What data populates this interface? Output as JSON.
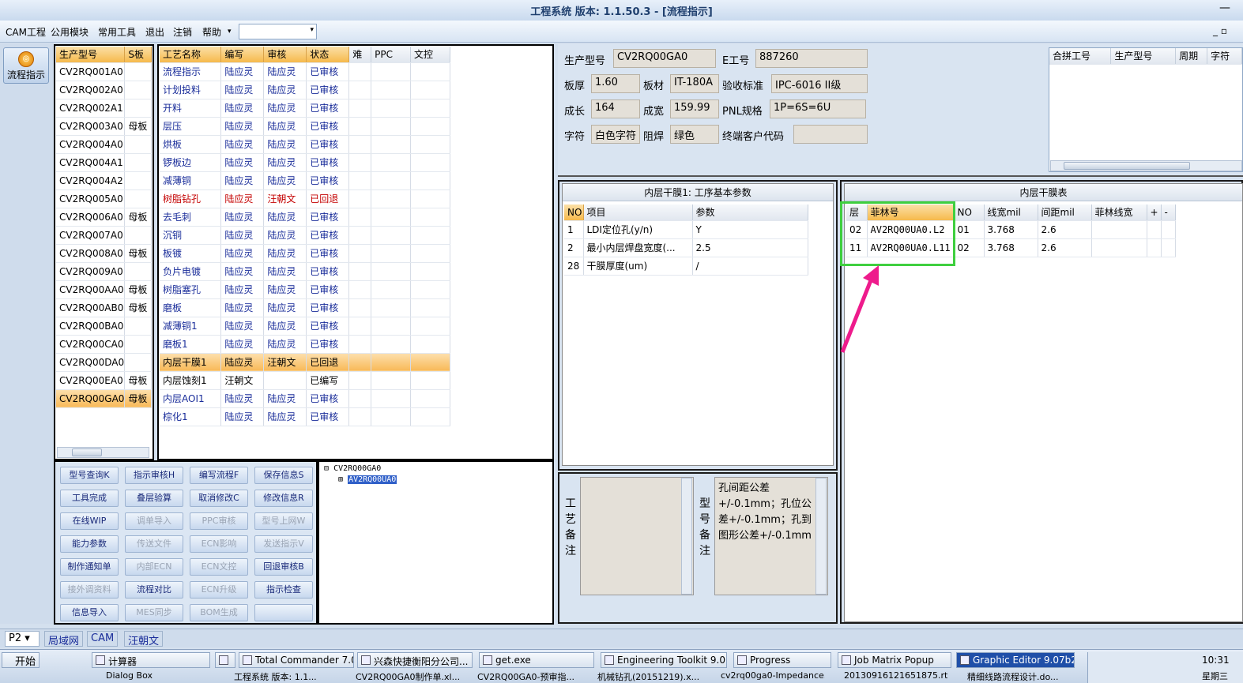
{
  "window": {
    "title": "工程系统  版本: 1.1.50.3 - [流程指示]"
  },
  "menu": {
    "items": [
      "CAM工程",
      "公用模块",
      "常用工具",
      "退出",
      "注销",
      "帮助"
    ],
    "dropdown_glyph": "▾"
  },
  "left_button": {
    "label": "流程指示"
  },
  "model_table": {
    "headers": [
      "生产型号",
      "S板"
    ],
    "rows": [
      [
        "CV2RQ001A0",
        ""
      ],
      [
        "CV2RQ002A0",
        ""
      ],
      [
        "CV2RQ002A1",
        ""
      ],
      [
        "CV2RQ003A0",
        "母板"
      ],
      [
        "CV2RQ004A0",
        ""
      ],
      [
        "CV2RQ004A1",
        ""
      ],
      [
        "CV2RQ004A2",
        ""
      ],
      [
        "CV2RQ005A0",
        ""
      ],
      [
        "CV2RQ006A0",
        "母板"
      ],
      [
        "CV2RQ007A0",
        ""
      ],
      [
        "CV2RQ008A0",
        "母板"
      ],
      [
        "CV2RQ009A0",
        ""
      ],
      [
        "CV2RQ00AA0",
        "母板"
      ],
      [
        "CV2RQ00AB0",
        "母板"
      ],
      [
        "CV2RQ00BA0",
        ""
      ],
      [
        "CV2RQ00CA0",
        ""
      ],
      [
        "CV2RQ00DA0",
        ""
      ],
      [
        "CV2RQ00EA0",
        "母板"
      ],
      [
        "CV2RQ00GA0",
        "母板"
      ]
    ],
    "selected_index": 18
  },
  "process_table": {
    "headers": [
      "工艺名称",
      "编写",
      "审核",
      "状态",
      "难",
      "PPC",
      "文控"
    ],
    "rows": [
      [
        "流程指示",
        "陆应灵",
        "陆应灵",
        "已审核"
      ],
      [
        "计划投料",
        "陆应灵",
        "陆应灵",
        "已审核"
      ],
      [
        "开料",
        "陆应灵",
        "陆应灵",
        "已审核"
      ],
      [
        "层压",
        "陆应灵",
        "陆应灵",
        "已审核"
      ],
      [
        "烘板",
        "陆应灵",
        "陆应灵",
        "已审核"
      ],
      [
        "锣板边",
        "陆应灵",
        "陆应灵",
        "已审核"
      ],
      [
        "减薄铜",
        "陆应灵",
        "陆应灵",
        "已审核"
      ],
      [
        "树脂钻孔",
        "陆应灵",
        "汪朝文",
        "已回退"
      ],
      [
        "去毛刺",
        "陆应灵",
        "陆应灵",
        "已审核"
      ],
      [
        "沉铜",
        "陆应灵",
        "陆应灵",
        "已审核"
      ],
      [
        "板镀",
        "陆应灵",
        "陆应灵",
        "已审核"
      ],
      [
        "负片电镀",
        "陆应灵",
        "陆应灵",
        "已审核"
      ],
      [
        "树脂塞孔",
        "陆应灵",
        "陆应灵",
        "已审核"
      ],
      [
        "磨板",
        "陆应灵",
        "陆应灵",
        "已审核"
      ],
      [
        "减薄铜1",
        "陆应灵",
        "陆应灵",
        "已审核"
      ],
      [
        "磨板1",
        "陆应灵",
        "陆应灵",
        "已审核"
      ],
      [
        "内层干膜1",
        "陆应灵",
        "汪朝文",
        "已回退"
      ],
      [
        "内层蚀刻1",
        "汪朝文",
        "",
        "已编写"
      ],
      [
        "内层AOI1",
        "陆应灵",
        "陆应灵",
        "已审核"
      ],
      [
        "棕化1",
        "陆应灵",
        "陆应灵",
        "已审核"
      ]
    ],
    "selected_index": 16,
    "red_index": 7,
    "black_indices": [
      16,
      17
    ]
  },
  "buttons": [
    [
      "型号查询K",
      "指示审核H",
      "编写流程F",
      "保存信息S"
    ],
    [
      "工具完成",
      "叠层验算",
      "取消修改C",
      "修改信息R"
    ],
    [
      "在线WIP",
      "调单导入",
      "PPC审核",
      "型号上网W"
    ],
    [
      "能力参数",
      "传送文件",
      "ECN影响",
      "发送指示V"
    ],
    [
      "制作通知单",
      "内部ECN",
      "ECN文控",
      "回退审核B"
    ],
    [
      "接外调资料",
      "流程对比",
      "ECN升级",
      "指示检查"
    ],
    [
      "信息导入",
      "MES同步",
      "BOM生成",
      ""
    ]
  ],
  "disabled_buttons": [
    "调单导入",
    "PPC审核",
    "型号上网W",
    "传送文件",
    "ECN影响",
    "发送指示V",
    "内部ECN",
    "ECN文控",
    "接外调资料",
    "ECN升级",
    "MES同步",
    "BOM生成"
  ],
  "tree": {
    "root": "CV2RQ00GA0",
    "child": "AV2RQ00UA0",
    "expander": "⊟",
    "child_expander": "⊞"
  },
  "info": {
    "生产型号_label": "生产型号",
    "生产型号": "CV2RQ00GA0",
    "E工号_label": "E工号",
    "E工号": "887260",
    "板厚_label": "板厚",
    "板厚": "1.60",
    "板材_label": "板材",
    "板材": "IT-180A",
    "验收标准_label": "验收标准",
    "验收标准": "IPC-6016 II级",
    "成长_label": "成长",
    "成长": "164",
    "成宽_label": "成宽",
    "成宽": "159.99",
    "PNL规格_label": "PNL规格",
    "PNL规格": "1P=6S=6U",
    "字符_label": "字符",
    "字符": "白色字符",
    "阻焊_label": "阻焊",
    "阻焊": "绿色",
    "终端客户代码_label": "终端客户代码",
    "终端客户代码": ""
  },
  "merge_table": {
    "headers": [
      "合拼工号",
      "生产型号",
      "周期",
      "字符"
    ]
  },
  "params": {
    "title": "内层干膜1: 工序基本参数",
    "headers": [
      "NO",
      "项目",
      "参数"
    ],
    "rows": [
      [
        "1",
        "LDI定位孔(y/n)",
        "Y"
      ],
      [
        "2",
        "最小内层焊盘宽度(...",
        "2.5"
      ],
      [
        "28",
        "干膜厚度(um)",
        "/"
      ]
    ]
  },
  "film": {
    "title": "内层干膜表",
    "headers": [
      "层",
      "菲林号",
      "NO",
      "线宽mil",
      "间距mil",
      "菲林线宽",
      "+",
      "-"
    ],
    "rows": [
      [
        "02",
        "AV2RQ00UA0.L2",
        "01",
        "3.768",
        "2.6"
      ],
      [
        "11",
        "AV2RQ00UA0.L11",
        "02",
        "3.768",
        "2.6"
      ]
    ]
  },
  "notes": {
    "process_label": "工艺备注",
    "model_label": "型号备注",
    "process_text": "",
    "model_text": "孔间距公差+/-0.1mm；孔位公差+/-0.1mm；孔到图形公差+/-0.1mm"
  },
  "status": {
    "left": "P2",
    "tabs": [
      "局域网",
      "CAM",
      "汪朝文"
    ]
  },
  "taskbar": {
    "start": "开始",
    "row1": [
      "计算器",
      "",
      "Total Commander 7.0 ...",
      "兴森快捷衡阳分公司...",
      "get.exe",
      "Engineering Toolkit 9.0...",
      "Progress",
      "Job Matrix Popup",
      "Graphic Editor 9.07b2 ..."
    ],
    "row2": [
      "Dialog Box",
      "工程系统  版本: 1.1...",
      "CV2RQ00GA0制作单.xl...",
      "CV2RQ00GA0-预审指...",
      "机械钻孔(20151219).x...",
      "cv2rq00ga0-Impedance...",
      "20130916121651875.rt...",
      "精细线路流程设计.do..."
    ],
    "clock": "10:31",
    "day": "星期三"
  },
  "colors": {
    "accent": "#f6b94c",
    "highlight_box": "#3fcf3f",
    "arrow": "#ee1b8c"
  }
}
